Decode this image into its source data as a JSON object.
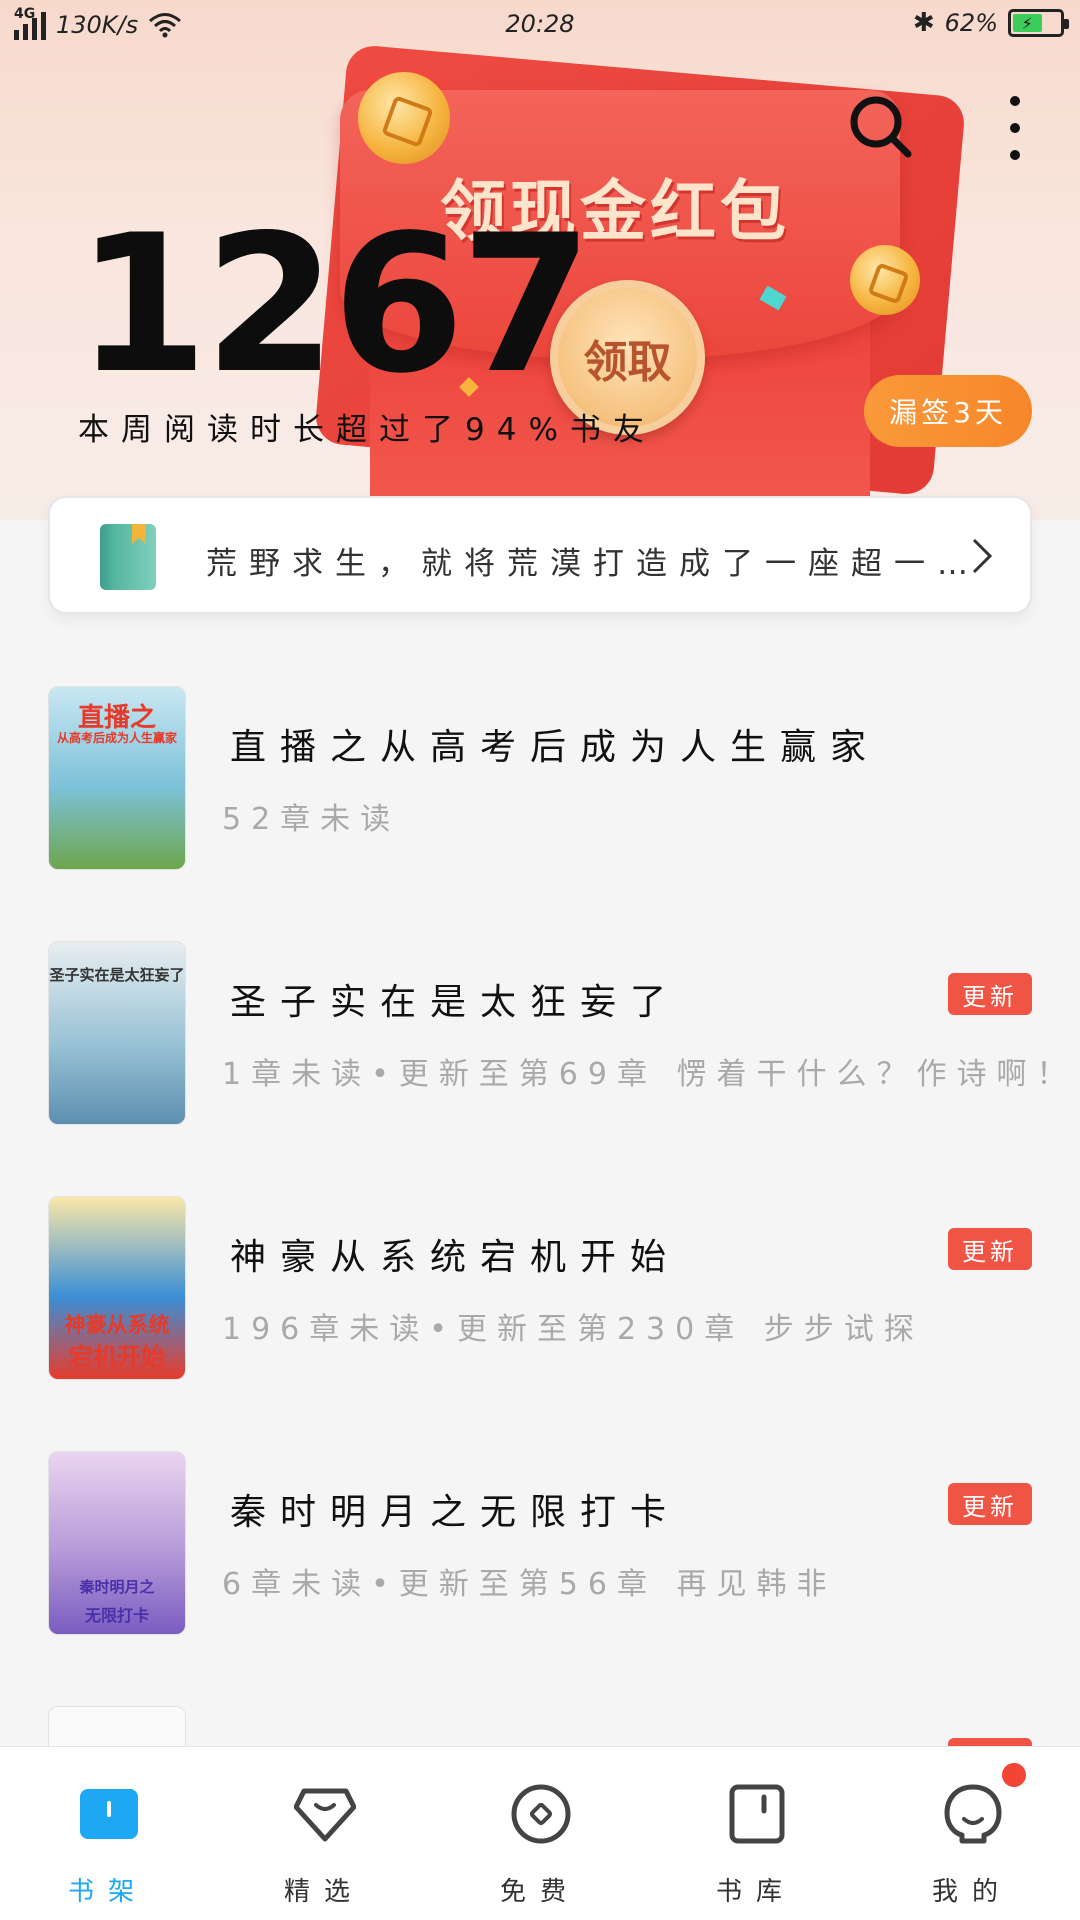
{
  "status_bar": {
    "network": "4G",
    "speed": "130K/s",
    "time": "20:28",
    "battery_pct": "62%",
    "battery_level": 0.62
  },
  "banner": {
    "title": "领现金红包",
    "button": "领取"
  },
  "stats": {
    "minutes": "1267",
    "caption": "本周阅读时长超过了94%书友"
  },
  "checkin": {
    "label": "漏签3天"
  },
  "recent": {
    "text": "荒野求生，就将荒漠打造成了一座超一…"
  },
  "books": [
    {
      "title": "直播之从高考后成为人生赢家",
      "meta": "52章未读",
      "updated": false,
      "cover_title": "直播之",
      "cover_sub": "从高考后成为人生赢家",
      "cover_colors": [
        "#c9e7f2",
        "#7cc1d8",
        "#6ea64e"
      ]
    },
    {
      "title": "圣子实在是太狂妄了",
      "meta": "1章未读•更新至第69章 愣着干什么？作诗啊！",
      "updated": true,
      "cover_title": "圣子实在是太狂妄了",
      "cover_sub": "",
      "cover_colors": [
        "#e8eef0",
        "#9ac3d6",
        "#5d8fb0"
      ]
    },
    {
      "title": "神豪从系统宕机开始",
      "meta": "196章未读•更新至第230章 步步试探",
      "updated": true,
      "cover_title": "神豪从系统",
      "cover_sub": "宕机开始",
      "cover_colors": [
        "#fbe8a8",
        "#3b8fd6",
        "#e83c2c"
      ]
    },
    {
      "title": "秦时明月之无限打卡",
      "meta": "6章未读•更新至第56章 再见韩非",
      "updated": true,
      "cover_title": "秦时明月之",
      "cover_sub": "无限打卡",
      "cover_colors": [
        "#e9d5f0",
        "#b49ad8",
        "#7a5cc0"
      ]
    }
  ],
  "update_label": "更新",
  "nav": [
    {
      "label": "书架",
      "icon": "bookshelf-icon",
      "active": true
    },
    {
      "label": "精选",
      "icon": "diamond-icon",
      "active": false
    },
    {
      "label": "免费",
      "icon": "disc-icon",
      "active": false
    },
    {
      "label": "书库",
      "icon": "book-icon",
      "active": false
    },
    {
      "label": "我的",
      "icon": "profile-icon",
      "active": false
    }
  ],
  "colors": {
    "accent": "#1ea7f2",
    "update_badge": "#ef5445",
    "checkin_badge": "#f7862a"
  }
}
